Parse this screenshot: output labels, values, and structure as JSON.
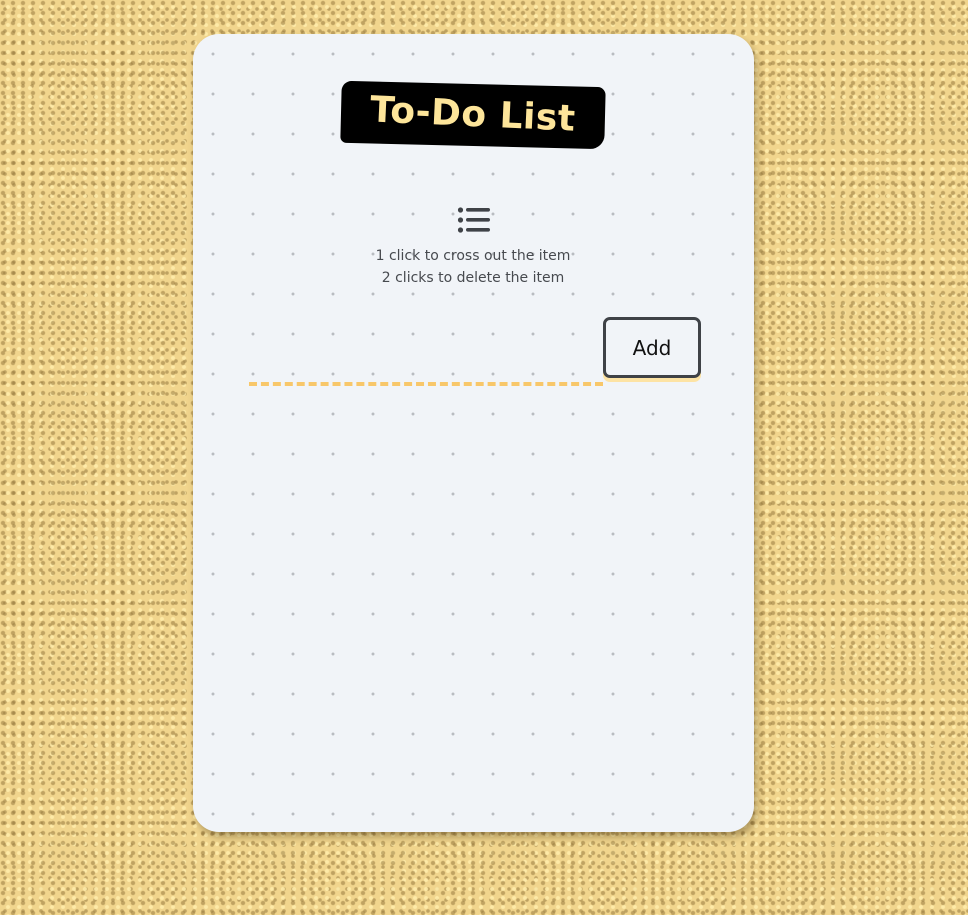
{
  "app": {
    "title": "To-Do List"
  },
  "instructions": {
    "icon": "list-icon",
    "line1": "1 click to cross out the item",
    "line2": "2 clicks to delete the item"
  },
  "form": {
    "input_value": "",
    "input_placeholder": "",
    "add_label": "Add"
  },
  "items": [],
  "colors": {
    "background": "#f1d58d",
    "card": "#f1f4f8",
    "title_bg": "#000000",
    "title_text": "#fde59a",
    "input_underline": "#f8c76a",
    "button_border": "#3f4247"
  }
}
